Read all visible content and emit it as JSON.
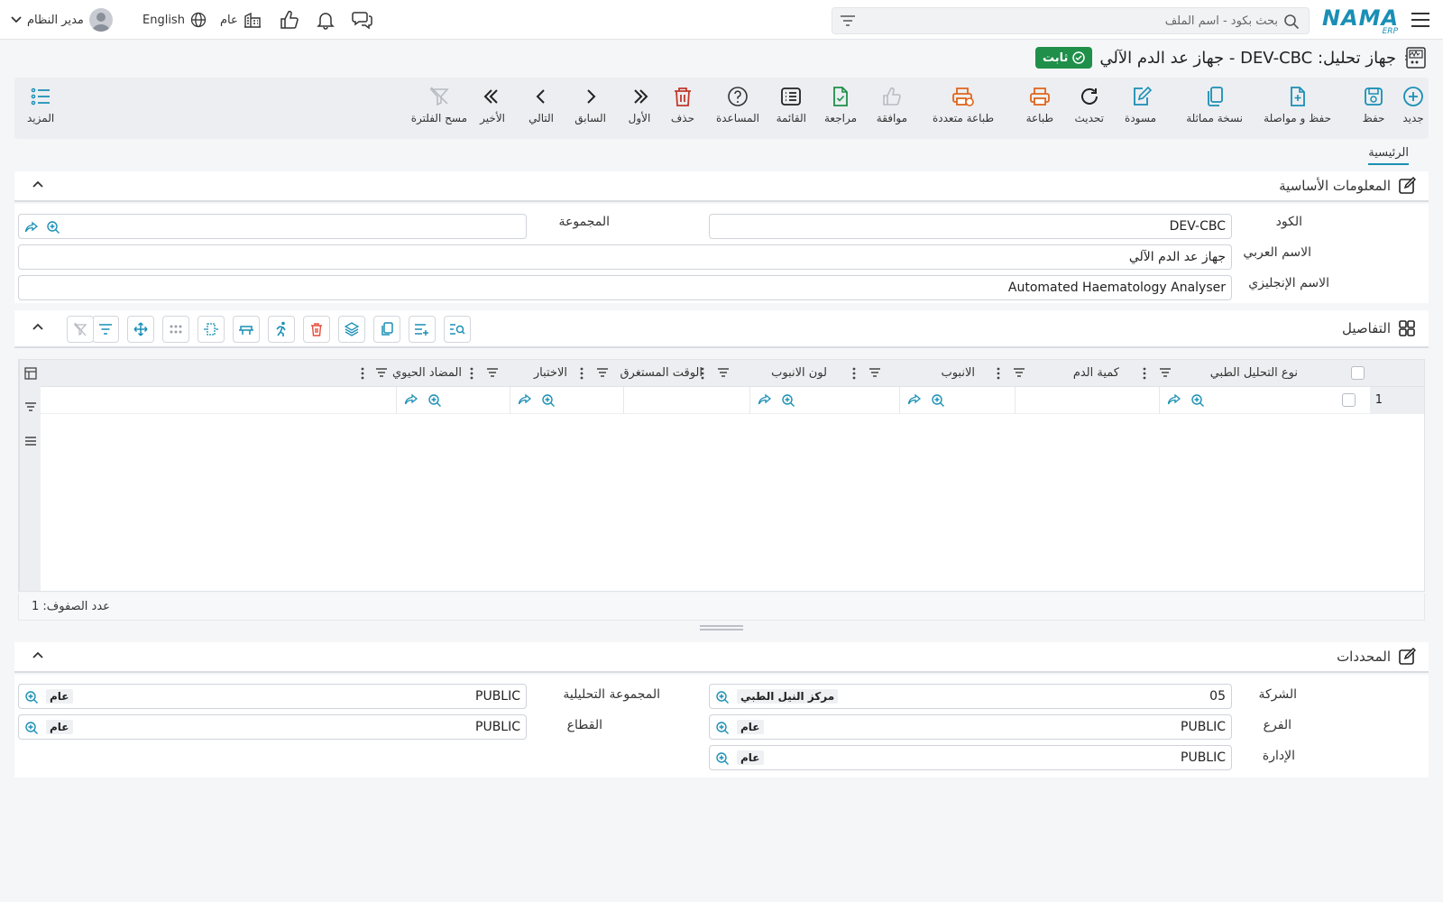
{
  "topbar": {
    "search_placeholder": "بحث بكود - اسم الملف",
    "language": "English",
    "branch": "عام",
    "user_name": "مدير النظام",
    "logo_text": "NAMA",
    "logo_sub": "ERP"
  },
  "page": {
    "title": "جهاز تحليل: DEV-CBC - جهاز عد الدم الآلي",
    "status": "ثابت"
  },
  "toolbar": {
    "new": "جديد",
    "save": "حفظ",
    "save_continue": "حفظ و مواصلة",
    "duplicate": "نسخة مماثلة",
    "draft": "مسودة",
    "refresh": "تحديث",
    "print": "طباعة",
    "multi_print": "طباعة متعددة",
    "approve": "موافقة",
    "review": "مراجعة",
    "list": "القائمة",
    "help": "المساعدة",
    "delete": "حذف",
    "first": "الأول",
    "previous": "السابق",
    "next": "التالي",
    "last": "الأخير",
    "clear_filter": "مسح الفلترة",
    "more": "المزيد"
  },
  "tabs": {
    "main": "الرئيسية"
  },
  "basic_info": {
    "title": "المعلومات الأساسية",
    "code_label": "الكود",
    "code_value": "DEV-CBC",
    "group_label": "المجموعة",
    "group_value": "",
    "arabic_name_label": "الاسم العربي",
    "arabic_name_value": "جهاز عد الدم الآلي",
    "english_name_label": "الاسم الإنجليزي",
    "english_name_value": "Automated Haematology Analyser"
  },
  "details": {
    "title": "التفاصيل",
    "columns": [
      "نوع التحليل الطبي",
      "كمية الدم",
      "الانبوب",
      "لون الانبوب",
      "الوقت المستغرق",
      "الاختبار",
      "المضاد الحيوي"
    ],
    "rows": [
      {
        "num": "1"
      }
    ],
    "row_count": "عدد الصفوف: 1"
  },
  "dimensions": {
    "title": "المحددات",
    "company_label": "الشركة",
    "company_code": "05",
    "company_name": "مركز النيل الطبي",
    "branch_label": "الفرع",
    "branch_code": "PUBLIC",
    "branch_name": "عام",
    "department_label": "الإدارة",
    "department_code": "PUBLIC",
    "department_name": "عام",
    "analytic_label": "المجموعة التحليلية",
    "analytic_code": "PUBLIC",
    "analytic_name": "عام",
    "sector_label": "القطاع",
    "sector_code": "PUBLIC",
    "sector_name": "عام"
  }
}
